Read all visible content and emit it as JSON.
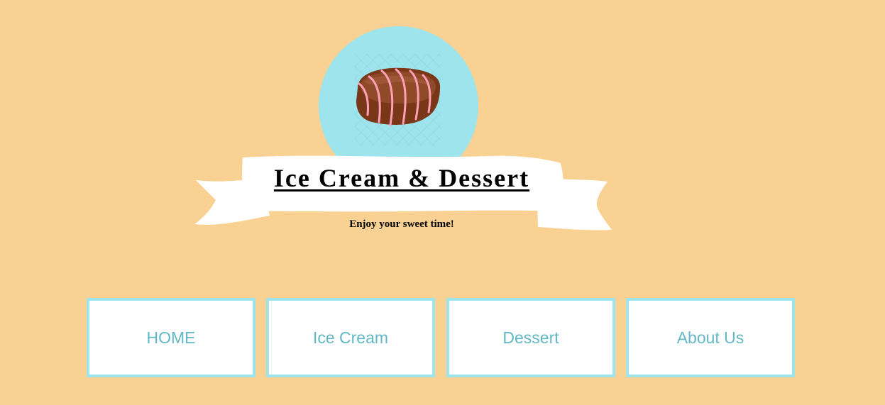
{
  "header": {
    "title": "Ice Cream & Dessert",
    "tagline": "Enjoy your sweet time!",
    "logo_icon": "chocolate-eclair-icon"
  },
  "nav": {
    "items": [
      {
        "label": "HOME"
      },
      {
        "label": "Ice Cream"
      },
      {
        "label": "Dessert"
      },
      {
        "label": "About Us"
      }
    ]
  },
  "colors": {
    "background": "#f8d193",
    "accent": "#9ee4ec",
    "nav_text": "#62b9c5",
    "ribbon": "#ffffff"
  }
}
